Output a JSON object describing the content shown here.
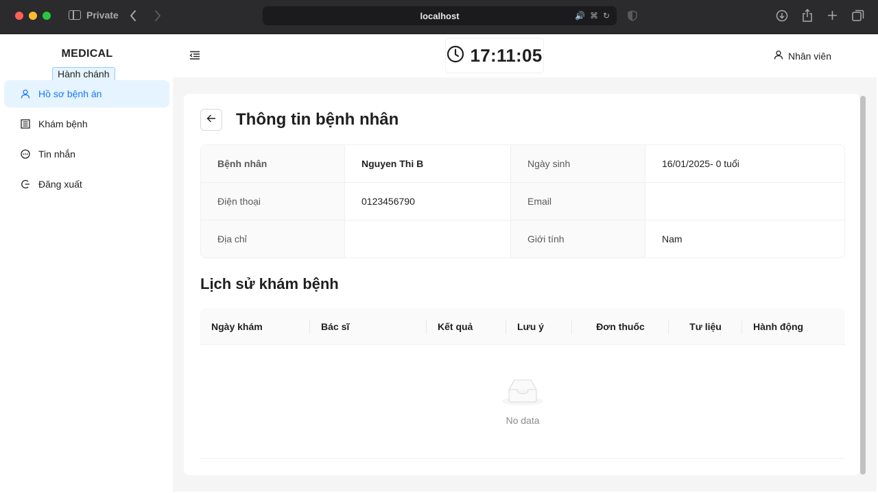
{
  "browser": {
    "private_label": "Private",
    "url": "localhost"
  },
  "sidebar": {
    "logo": "MEDICAL",
    "role_tag": "Hành chánh",
    "items": [
      {
        "label": "Hồ sơ bệnh án",
        "icon": "user-icon",
        "active": true
      },
      {
        "label": "Khám bệnh",
        "icon": "calculator-icon",
        "active": false
      },
      {
        "label": "Tin nhắn",
        "icon": "message-icon",
        "active": false
      },
      {
        "label": "Đăng xuất",
        "icon": "logout-icon",
        "active": false
      }
    ]
  },
  "header": {
    "clock": "17:11:05",
    "user_label": "Nhân viên"
  },
  "patient": {
    "title": "Thông tin bệnh nhân",
    "rows": [
      {
        "label1": "Bệnh nhân",
        "value1": "Nguyen Thi B",
        "label2": "Ngày sinh",
        "value2": "16/01/2025- 0 tuổi"
      },
      {
        "label1": "Điện thoại",
        "value1": "0123456790",
        "label2": "Email",
        "value2": ""
      },
      {
        "label1": "Địa chỉ",
        "value1": "",
        "label2": "Giới tính",
        "value2": "Nam"
      }
    ]
  },
  "history": {
    "title": "Lịch sử khám bệnh",
    "columns": [
      "Ngày khám",
      "Bác sĩ",
      "Kết quả",
      "Lưu ý",
      "Đơn thuốc",
      "Tư liệu",
      "Hành động"
    ],
    "empty_text": "No data"
  },
  "colors": {
    "accent": "#1677ff",
    "active_bg": "#e6f4ff",
    "content_bg": "#f5f5f5"
  }
}
